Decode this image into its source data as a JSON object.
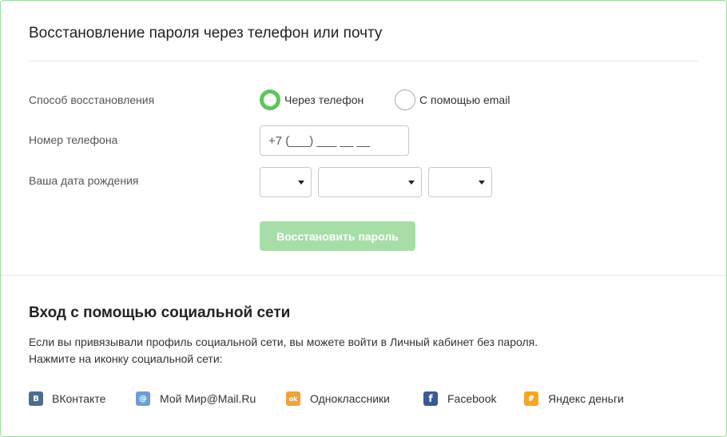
{
  "form": {
    "title": "Восстановление пароля через телефон или почту",
    "method_label": "Способ восстановления",
    "method_options": [
      {
        "label": "Через телефон",
        "checked": true
      },
      {
        "label": "С помощью email",
        "checked": false
      }
    ],
    "phone_label": "Номер телефона",
    "phone_value": "+7 (___) ___ __ __",
    "birth_label": "Ваша дата рождения",
    "day_value": "",
    "month_value": "",
    "year_value": "",
    "submit_label": "Восстановить пароль"
  },
  "social": {
    "title": "Вход с помощью социальной сети",
    "description_line1": "Если вы привязывали профиль социальной сети, вы можете войти в Личный кабинет без пароля.",
    "description_line2": "Нажмите на иконку социальной сети:",
    "items": [
      {
        "label": "ВКонтакте",
        "icon": "vk-icon",
        "color": "#4a6c91",
        "glyph": "B"
      },
      {
        "label": "Мой Мир@Mail.Ru",
        "icon": "mailru-icon",
        "color": "#6d9ed6",
        "glyph": "@"
      },
      {
        "label": "Одноклассники",
        "icon": "odnoklassniki-icon",
        "color": "#f0a23b",
        "glyph": "ok"
      },
      {
        "label": "Facebook",
        "icon": "facebook-icon",
        "color": "#3b5998",
        "glyph": "f"
      },
      {
        "label": "Яндекс деньги",
        "icon": "yandex-money-icon",
        "color": "#f5a623",
        "glyph": "₽"
      }
    ]
  },
  "colors": {
    "accent": "#5fc35f",
    "button_disabled": "#a7dea7",
    "frame_border": "#9fd99f"
  }
}
